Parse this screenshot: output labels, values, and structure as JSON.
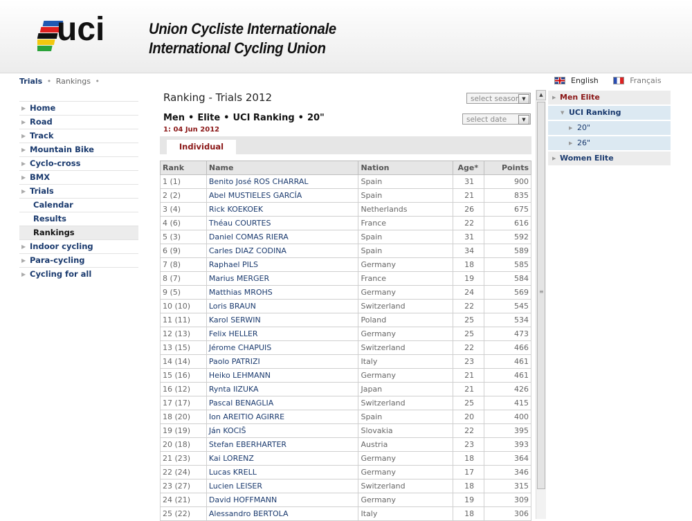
{
  "header": {
    "title_fr": "Union Cycliste Internationale",
    "title_en": "International Cycling Union",
    "logo_text": "uci"
  },
  "breadcrumb": {
    "current": "Trials",
    "sep": "•",
    "next": "Rankings"
  },
  "languages": {
    "english": "English",
    "french": "Français"
  },
  "leftnav": [
    {
      "label": "Home"
    },
    {
      "label": "Road"
    },
    {
      "label": "Track"
    },
    {
      "label": "Mountain Bike"
    },
    {
      "label": "Cyclo-cross"
    },
    {
      "label": "BMX"
    },
    {
      "label": "Trials"
    },
    {
      "label": "Calendar",
      "sub": true
    },
    {
      "label": "Results",
      "sub": true
    },
    {
      "label": "Rankings",
      "sub": true,
      "active": true
    },
    {
      "label": "Indoor cycling"
    },
    {
      "label": "Para-cycling"
    },
    {
      "label": "Cycling for all"
    }
  ],
  "content": {
    "title": "Ranking - Trials 2012",
    "season_placeholder": "select season",
    "date_placeholder": "select date",
    "subtitle": [
      "Men",
      "Elite",
      "UCI Ranking",
      "20\""
    ],
    "date_line": "1: 04 Jun 2012",
    "tab": "Individual"
  },
  "table": {
    "headers": {
      "rank": "Rank",
      "name": "Name",
      "nation": "Nation",
      "age": "Age*",
      "points": "Points"
    },
    "rows": [
      {
        "rank": "1 (1)",
        "name": "Benito José ROS CHARRAL",
        "nation": "Spain",
        "age": "31",
        "points": "900"
      },
      {
        "rank": "2 (2)",
        "name": "Abel MUSTIELES GARCÍA",
        "nation": "Spain",
        "age": "21",
        "points": "835"
      },
      {
        "rank": "3 (4)",
        "name": "Rick KOEKOEK",
        "nation": "Netherlands",
        "age": "26",
        "points": "675"
      },
      {
        "rank": "4 (6)",
        "name": "Théau COURTES",
        "nation": "France",
        "age": "22",
        "points": "616"
      },
      {
        "rank": "5 (3)",
        "name": "Daniel COMAS RIERA",
        "nation": "Spain",
        "age": "31",
        "points": "592"
      },
      {
        "rank": "6 (9)",
        "name": "Carles DIAZ CODINA",
        "nation": "Spain",
        "age": "34",
        "points": "589"
      },
      {
        "rank": "7 (8)",
        "name": "Raphael PILS",
        "nation": "Germany",
        "age": "18",
        "points": "585"
      },
      {
        "rank": "8 (7)",
        "name": "Marius MERGER",
        "nation": "France",
        "age": "19",
        "points": "584"
      },
      {
        "rank": "9 (5)",
        "name": "Matthias MROHS",
        "nation": "Germany",
        "age": "24",
        "points": "569"
      },
      {
        "rank": "10 (10)",
        "name": "Loris BRAUN",
        "nation": "Switzerland",
        "age": "22",
        "points": "545"
      },
      {
        "rank": "11 (11)",
        "name": "Karol SERWIN",
        "nation": "Poland",
        "age": "25",
        "points": "534"
      },
      {
        "rank": "12 (13)",
        "name": "Felix HELLER",
        "nation": "Germany",
        "age": "25",
        "points": "473"
      },
      {
        "rank": "13 (15)",
        "name": "Jérome CHAPUIS",
        "nation": "Switzerland",
        "age": "22",
        "points": "466"
      },
      {
        "rank": "14 (14)",
        "name": "Paolo PATRIZI",
        "nation": "Italy",
        "age": "23",
        "points": "461"
      },
      {
        "rank": "15 (16)",
        "name": "Heiko LEHMANN",
        "nation": "Germany",
        "age": "21",
        "points": "461"
      },
      {
        "rank": "16 (12)",
        "name": "Rynta IIZUKA",
        "nation": "Japan",
        "age": "21",
        "points": "426"
      },
      {
        "rank": "17 (17)",
        "name": "Pascal BENAGLIA",
        "nation": "Switzerland",
        "age": "25",
        "points": "415"
      },
      {
        "rank": "18 (20)",
        "name": "Ion AREITIO AGIRRE",
        "nation": "Spain",
        "age": "20",
        "points": "400"
      },
      {
        "rank": "19 (19)",
        "name": "Ján KOCIŠ",
        "nation": "Slovakia",
        "age": "22",
        "points": "395"
      },
      {
        "rank": "20 (18)",
        "name": "Stefan EBERHARTER",
        "nation": "Austria",
        "age": "23",
        "points": "393"
      },
      {
        "rank": "21 (23)",
        "name": "Kai LORENZ",
        "nation": "Germany",
        "age": "18",
        "points": "364"
      },
      {
        "rank": "22 (24)",
        "name": "Lucas KRELL",
        "nation": "Germany",
        "age": "17",
        "points": "346"
      },
      {
        "rank": "23 (27)",
        "name": "Lucien LEISER",
        "nation": "Switzerland",
        "age": "18",
        "points": "315"
      },
      {
        "rank": "24 (21)",
        "name": "David HOFFMANN",
        "nation": "Germany",
        "age": "19",
        "points": "309"
      },
      {
        "rank": "25 (22)",
        "name": "Alessandro BERTOLA",
        "nation": "Italy",
        "age": "18",
        "points": "306"
      }
    ]
  },
  "rightnav": {
    "men_elite": "Men Elite",
    "uci_ranking": "UCI Ranking",
    "sub_20": "20\"",
    "sub_26": "26\"",
    "women_elite": "Women Elite"
  },
  "colors": {
    "brand_navy": "#1a3a6e",
    "accent_red": "#8a1616"
  }
}
